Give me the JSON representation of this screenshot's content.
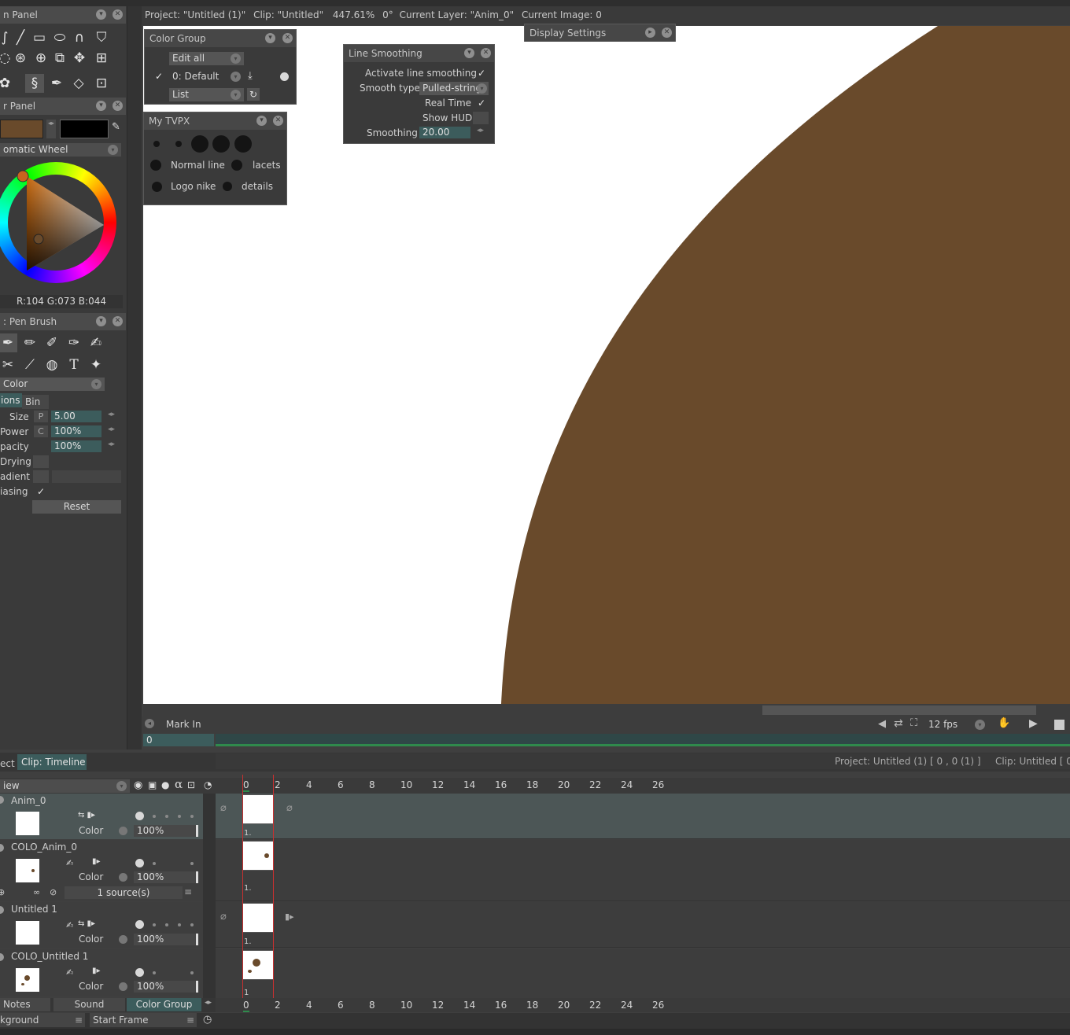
{
  "status_bar": {
    "project": "Project: \"Untitled (1)\"",
    "clip": "Clip: \"Untitled\"",
    "zoom": "447.61%",
    "angle": "0°",
    "current_layer": "Current Layer: \"Anim_0\"",
    "current_image": "Current Image: 0"
  },
  "left": {
    "tools_panel_title": "n Panel",
    "color_panel_title": "r Panel",
    "wheel_mode": "omatic Wheel",
    "rgb_readout": "R:104 G:073 B:044",
    "brush_panel_title": ": Pen Brush",
    "brush_mode": "Color",
    "tab_options": "ions",
    "tab_bin": "Bin",
    "size_label": "Size",
    "size_prefix": "P",
    "size_value": "5.00",
    "power_label": "Power",
    "power_prefix": "C",
    "power_value": "100%",
    "opacity_label": "pacity",
    "opacity_value": "100%",
    "drying_label": "Drying",
    "gradient_label": "adient",
    "aliasing_label": "iasing",
    "reset_label": "Reset"
  },
  "color_group": {
    "title": "Color Group",
    "edit_all": "Edit all",
    "default_group": "0: Default",
    "list": "List"
  },
  "my_tvpx": {
    "title": "My TVPX",
    "presets": [
      "Normal line",
      "lacets",
      "Logo nike",
      "details"
    ]
  },
  "line_smoothing": {
    "title": "Line Smoothing",
    "activate_label": "Activate line smoothing",
    "smooth_type_label": "Smooth type",
    "smooth_type_value": "Pulled-string",
    "real_time_label": "Real Time",
    "show_hud_label": "Show HUD",
    "smoothing_label": "Smoothing",
    "smoothing_value": "20.00"
  },
  "display_settings": {
    "title": "Display Settings"
  },
  "playback": {
    "mark_in": "Mark In",
    "fps": "12 fps",
    "frame": "0",
    "progress": 1.0
  },
  "timeline": {
    "tab_project": "ect",
    "tab_clip": "Clip: Timeline",
    "project_info": "Project: Untitled (1) [ 0 , 0  (1) ]",
    "clip_info": "Clip: Untitled [ 0 ,",
    "view_label": "iew",
    "ruler": [
      "0",
      "2",
      "4",
      "6",
      "8",
      "10",
      "12",
      "14",
      "16",
      "18",
      "20",
      "22",
      "24",
      "26"
    ],
    "layers": [
      {
        "name": "Anim_0",
        "blend": "Color",
        "opacity": "100%",
        "frame_label": "1."
      },
      {
        "name": "COLO_Anim_0",
        "blend": "Color",
        "opacity": "100%",
        "frame_label": "1.",
        "sources": "1 source(s)"
      },
      {
        "name": "Untitled 1",
        "blend": "Color",
        "opacity": "100%",
        "frame_label": "1."
      },
      {
        "name": "COLO_Untitled 1",
        "blend": "Color",
        "opacity": "100%",
        "frame_label": "1"
      }
    ],
    "bottom_tabs": [
      "Notes",
      "Sound",
      "Color Group"
    ],
    "background_label": "kground",
    "start_frame_label": "Start Frame"
  },
  "colors": {
    "paint_brown": "#694a2b",
    "accent_teal": "#3c5c5c",
    "progress_green": "#2f8a4c",
    "marker_red": "#c83030"
  }
}
